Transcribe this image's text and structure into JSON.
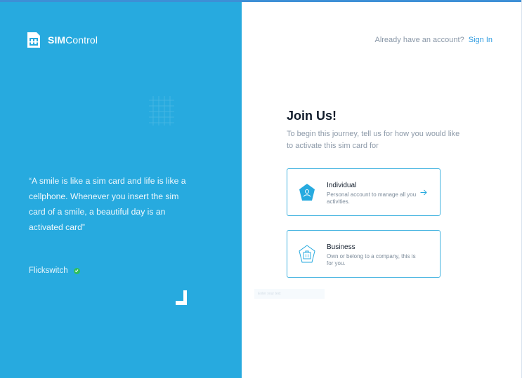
{
  "brand": {
    "name_bold": "SIM",
    "name_regular": "Control"
  },
  "quote": {
    "text": "“A smile is like a sim card and life is like a cellphone. Whenever you insert the sim card of a smile, a beautiful day is an activated card”",
    "author": "Flickswitch"
  },
  "header": {
    "signin_prompt": "Already have an account?",
    "signin_link": "Sign In"
  },
  "main": {
    "title": "Join Us!",
    "subtitle": "To begin this journey, tell us for how you would like to activate this sim card for",
    "options": [
      {
        "title": "Individual",
        "description": "Personal account to manage all you activities."
      },
      {
        "title": "Business",
        "description": "Own or belong to a company, this is for you."
      }
    ]
  },
  "overlay": {
    "faint_input_text": "Enter your text"
  },
  "icons": {
    "logo": "sim-card-icon",
    "check": "check-badge-icon",
    "individual": "user-icon",
    "business": "briefcase-icon",
    "arrow": "arrow-right-icon"
  },
  "colors": {
    "panel": "#27aadf",
    "accent": "#2d9be0",
    "card_border": "#43b3e0",
    "check": "#2fbf5a"
  }
}
